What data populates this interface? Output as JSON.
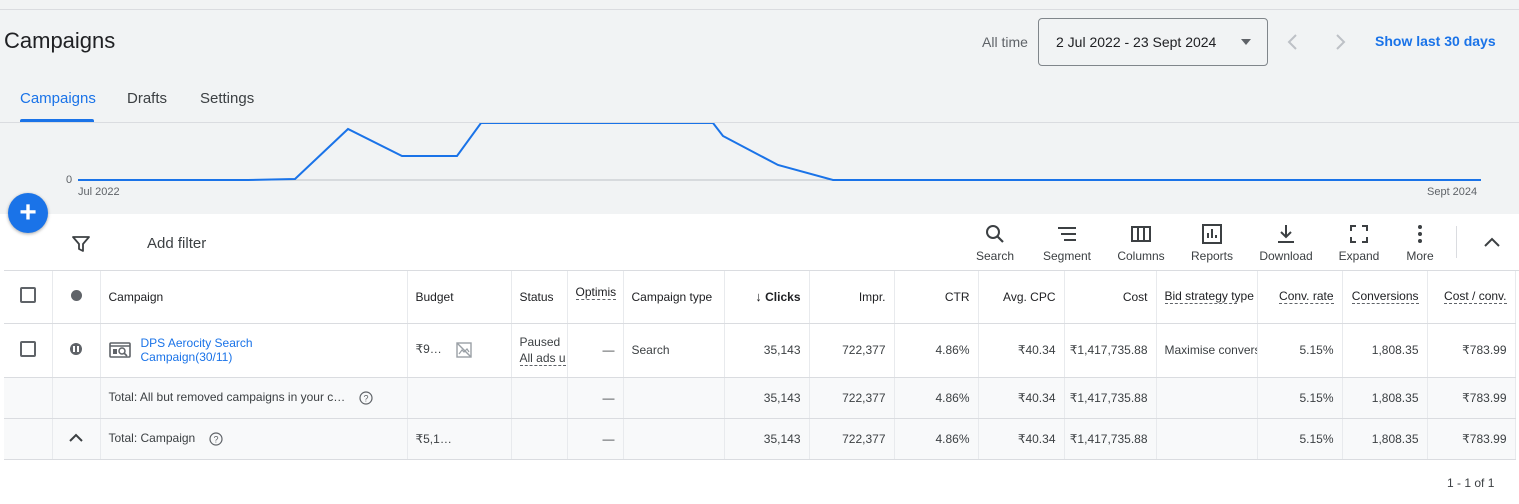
{
  "header": {
    "title": "Campaigns",
    "date_range_label": "All time",
    "date_range_value": "2 Jul 2022 - 23 Sept 2024",
    "show_last_label": "Show last 30 days"
  },
  "tabs": [
    {
      "label": "Campaigns",
      "active": true
    },
    {
      "label": "Drafts",
      "active": false
    },
    {
      "label": "Settings",
      "active": false
    }
  ],
  "chart_data": {
    "type": "line",
    "x_start_label": "Jul 2022",
    "x_end_label": "Sept 2024",
    "y_tick_label": "0",
    "color": "#1a73e8"
  },
  "toolbar": {
    "add_filter_label": "Add filter",
    "tools": [
      {
        "label": "Search",
        "icon": "search-icon"
      },
      {
        "label": "Segment",
        "icon": "segment-icon"
      },
      {
        "label": "Columns",
        "icon": "columns-icon"
      },
      {
        "label": "Reports",
        "icon": "reports-icon"
      },
      {
        "label": "Download",
        "icon": "download-icon"
      },
      {
        "label": "Expand",
        "icon": "expand-icon"
      },
      {
        "label": "More",
        "icon": "more-vert-icon"
      }
    ]
  },
  "table": {
    "headers": {
      "campaign": "Campaign",
      "budget": "Budget",
      "status": "Status",
      "optimisation": "Optimis",
      "campaign_type": "Campaign type",
      "clicks": "Clicks",
      "impr": "Impr.",
      "ctr": "CTR",
      "avg_cpc": "Avg. CPC",
      "cost": "Cost",
      "bid_strategy": "Bid strategy type",
      "conv_rate": "Conv. rate",
      "conversions": "Conversions",
      "cost_conv": "Cost / conv."
    },
    "row": {
      "campaign": "DPS Aerocity Search Campaign(30/11)",
      "budget": "₹9…",
      "status_line1": "Paused",
      "status_line2": "All ads u",
      "optimisation": "—",
      "campaign_type": "Search",
      "clicks": "35,143",
      "impr": "722,377",
      "ctr": "4.86%",
      "avg_cpc": "₹40.34",
      "cost": "₹1,417,735.88",
      "bid_strategy": "Maximise conversions (Target CPA)",
      "conv_rate": "5.15%",
      "conversions": "1,808.35",
      "cost_conv": "₹783.99"
    },
    "total_all": {
      "label": "Total: All but removed campaigns in your c…",
      "optimisation": "—",
      "clicks": "35,143",
      "impr": "722,377",
      "ctr": "4.86%",
      "avg_cpc": "₹40.34",
      "cost": "₹1,417,735.88",
      "conv_rate": "5.15%",
      "conversions": "1,808.35",
      "cost_conv": "₹783.99"
    },
    "total_campaign": {
      "label": "Total: Campaign",
      "budget": "₹5,1…",
      "optimisation": "—",
      "clicks": "35,143",
      "impr": "722,377",
      "ctr": "4.86%",
      "avg_cpc": "₹40.34",
      "cost": "₹1,417,735.88",
      "conv_rate": "5.15%",
      "conversions": "1,808.35",
      "cost_conv": "₹783.99"
    }
  },
  "pagination": "1 - 1 of 1"
}
